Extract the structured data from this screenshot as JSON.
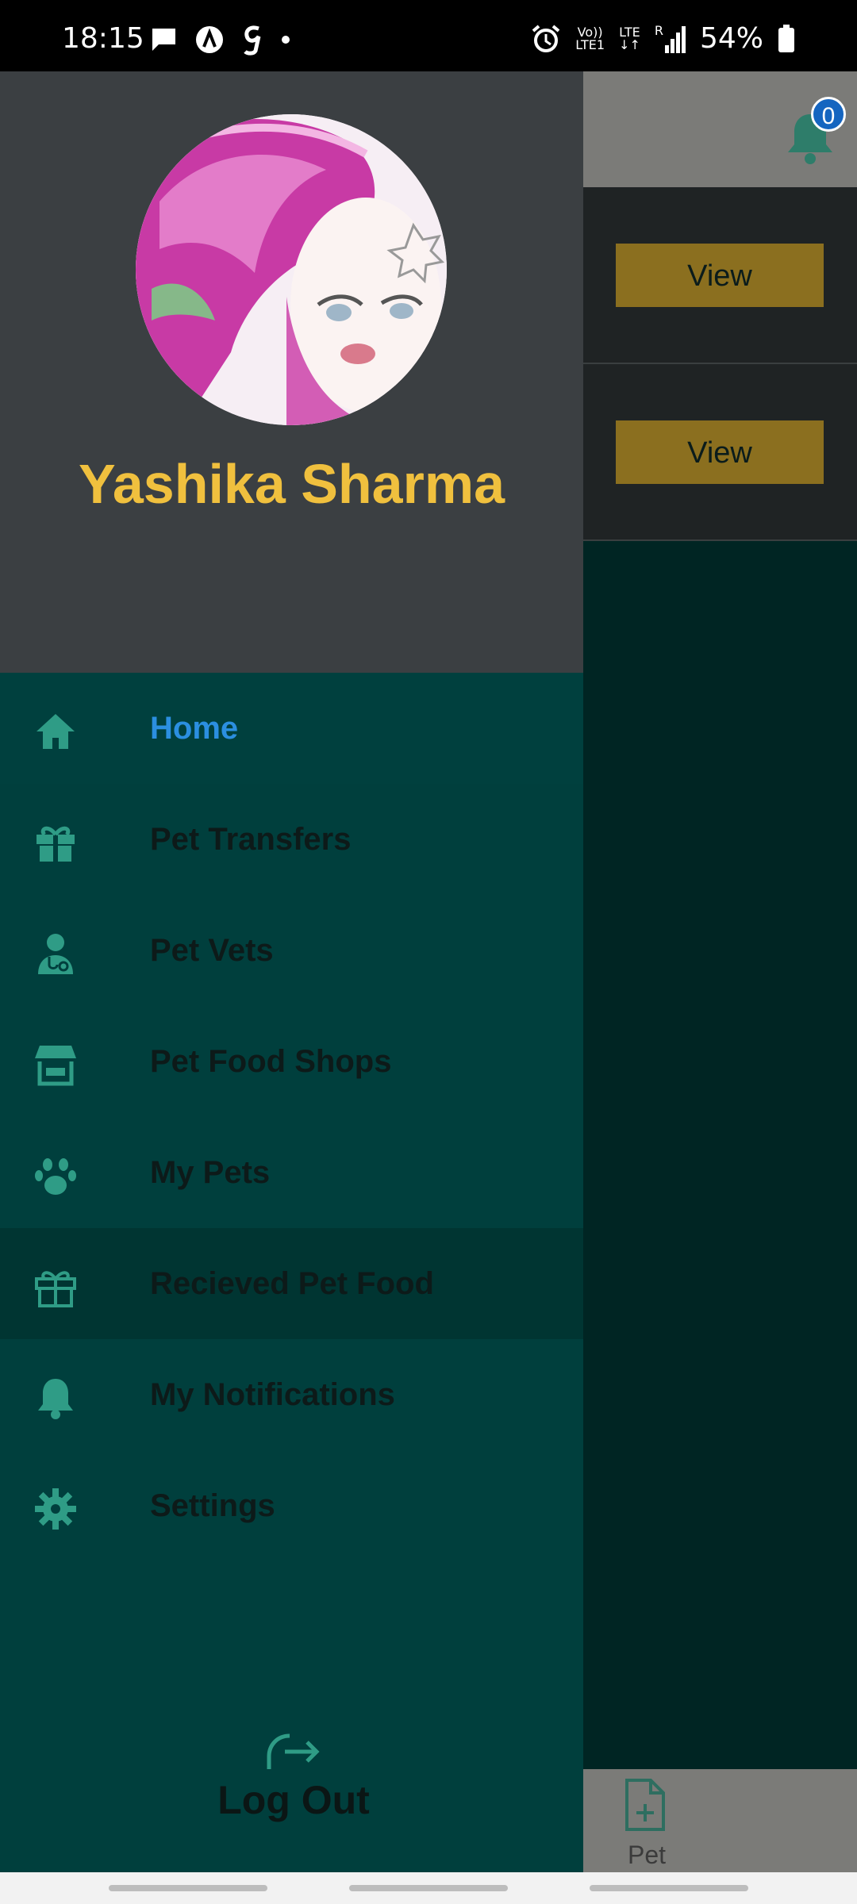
{
  "status_bar": {
    "time": "18:15",
    "left_icons": [
      "message-icon",
      "a-circle-icon",
      "g-icon",
      "dot-icon"
    ],
    "network": {
      "volte": "Vo))",
      "lte1": "LTE1",
      "lte": "LTE",
      "roaming": "R"
    },
    "battery": "54%"
  },
  "background_screen": {
    "notification_count": "0",
    "rows": [
      {
        "button": "View"
      },
      {
        "button": "View"
      }
    ],
    "bottom_nav": {
      "label": "Pet Request"
    }
  },
  "drawer": {
    "user_name": "Yashika Sharma",
    "menu": [
      {
        "label": "Home",
        "icon": "home-icon",
        "state": "active"
      },
      {
        "label": "Pet Transfers",
        "icon": "gift-icon"
      },
      {
        "label": "Pet Vets",
        "icon": "vet-icon"
      },
      {
        "label": "Pet Food Shops",
        "icon": "store-icon"
      },
      {
        "label": "My Pets",
        "icon": "paw-icon"
      },
      {
        "label": "Recieved Pet Food",
        "icon": "gift-outline-icon",
        "state": "highlighted"
      },
      {
        "label": "My Notifications",
        "icon": "bell-icon"
      },
      {
        "label": "Settings",
        "icon": "gear-icon"
      }
    ],
    "logout_label": "Log Out"
  },
  "colors": {
    "accent_name": "#f0c03e",
    "active_item": "#2b8fe0",
    "icon_teal": "#2f9c86",
    "drawer_bg": "#003f3d",
    "header_bg": "#3b3f42",
    "view_button": "#8b6f1f"
  }
}
